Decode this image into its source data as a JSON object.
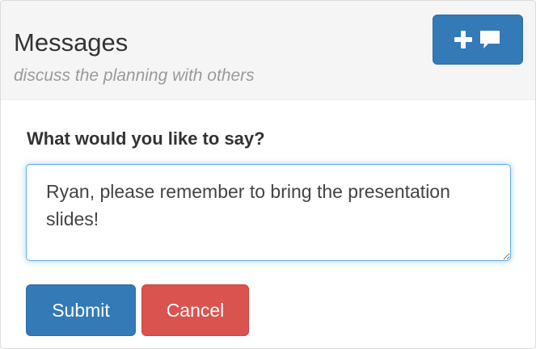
{
  "panel": {
    "title": "Messages",
    "subtitle": "discuss the planning with others",
    "new_message_button": {
      "icons": [
        "plus-icon",
        "comment-icon"
      ],
      "color": "#337ab7"
    }
  },
  "form": {
    "label": "What would you like to say?",
    "message_value": "Ryan, please remember to bring the presentation slides!",
    "submit_label": "Submit",
    "cancel_label": "Cancel"
  },
  "colors": {
    "primary": "#337ab7",
    "danger": "#d9534f",
    "focus_border": "#66afe9",
    "header_bg": "#f5f5f5",
    "subtitle_text": "#9a9a9a"
  }
}
